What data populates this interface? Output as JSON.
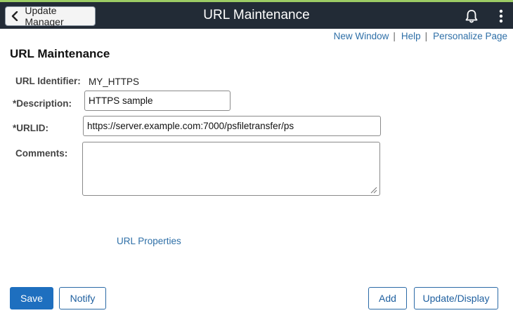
{
  "header": {
    "back_label": "Update Manager",
    "title": "URL Maintenance",
    "icons": [
      "chevron-left-icon",
      "bell-icon",
      "kebab-menu-icon"
    ],
    "background": "#222b36",
    "accent": "#9ccc65"
  },
  "toolbar": {
    "new_window": "New Window",
    "help": "Help",
    "personalize": "Personalize Page",
    "separator": "|"
  },
  "page": {
    "title": "URL Maintenance"
  },
  "form": {
    "url_identifier_label": "URL Identifier:",
    "url_identifier_value": "MY_HTTPS",
    "description_label": "*Description:",
    "description_value": "HTTPS sample",
    "urlid_label": "*URLID:",
    "urlid_value": "https://server.example.com:7000/psfiletransfer/ps",
    "comments_label": "Comments:",
    "comments_value": ""
  },
  "links": {
    "url_properties": "URL Properties"
  },
  "footer": {
    "save": "Save",
    "notify": "Notify",
    "add": "Add",
    "update_display": "Update/Display"
  },
  "colors": {
    "link": "#2e6fa7",
    "primary_button": "#1e6fbf"
  }
}
